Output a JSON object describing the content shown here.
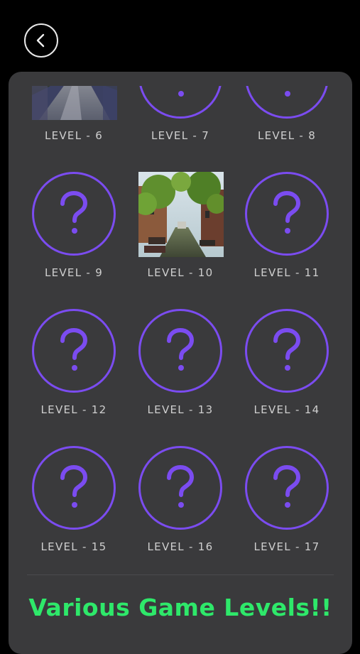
{
  "back_button": {
    "icon": "chevron-left-icon"
  },
  "levels": [
    {
      "label": "LEVEL - 6",
      "state": "unlocked",
      "image": "forest-road"
    },
    {
      "label": "LEVEL - 7",
      "state": "locked",
      "icon": "question-mark-icon"
    },
    {
      "label": "LEVEL - 8",
      "state": "locked",
      "icon": "question-mark-icon"
    },
    {
      "label": "LEVEL - 9",
      "state": "locked",
      "icon": "question-mark-icon"
    },
    {
      "label": "LEVEL - 10",
      "state": "unlocked",
      "image": "canal-street"
    },
    {
      "label": "LEVEL - 11",
      "state": "locked",
      "icon": "question-mark-icon"
    },
    {
      "label": "LEVEL - 12",
      "state": "locked",
      "icon": "question-mark-icon"
    },
    {
      "label": "LEVEL - 13",
      "state": "locked",
      "icon": "question-mark-icon"
    },
    {
      "label": "LEVEL - 14",
      "state": "locked",
      "icon": "question-mark-icon"
    },
    {
      "label": "LEVEL - 15",
      "state": "locked",
      "icon": "question-mark-icon"
    },
    {
      "label": "LEVEL - 16",
      "state": "locked",
      "icon": "question-mark-icon"
    },
    {
      "label": "LEVEL - 17",
      "state": "locked",
      "icon": "question-mark-icon"
    }
  ],
  "promo_text": "Various Game Levels!!",
  "colors": {
    "background": "#000000",
    "panel": "#3a3a3c",
    "locked_accent": "#7b4cf0",
    "label_text": "#cfcfcf",
    "promo_text": "#2ee86a"
  }
}
